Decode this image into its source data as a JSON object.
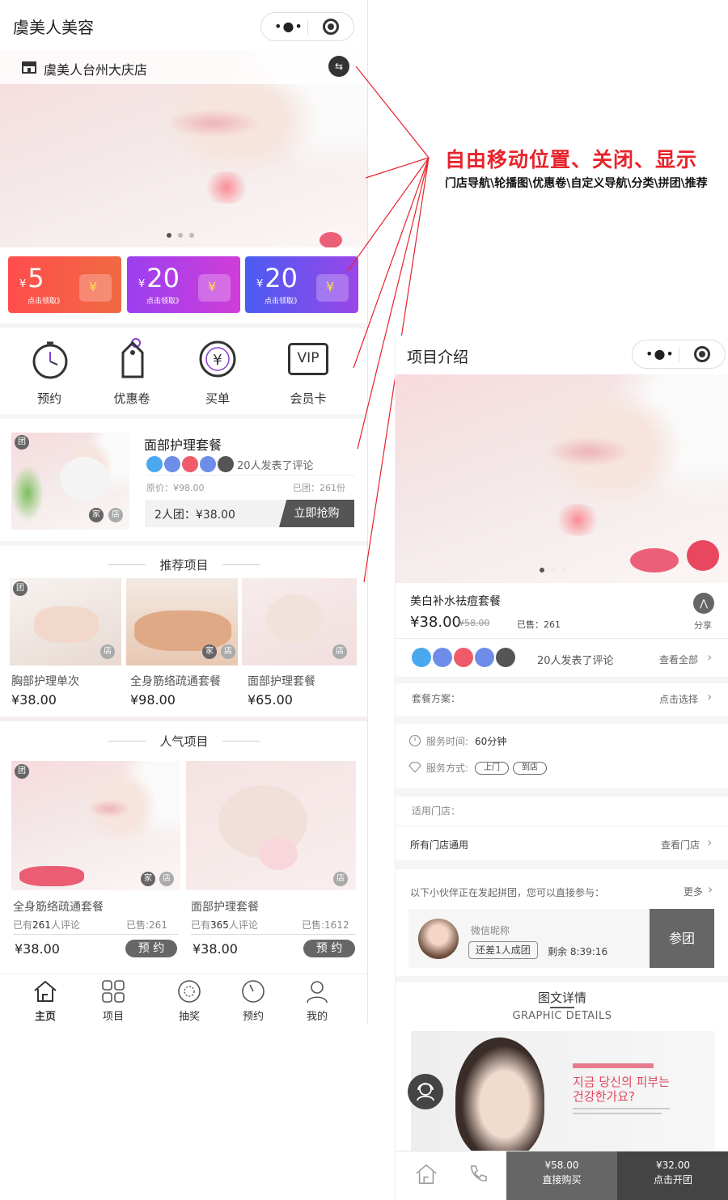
{
  "left_phone": {
    "app_title": "虞美人美容",
    "store_name": "虞美人台州大庆店",
    "coupons": [
      {
        "currency": "¥",
        "amount": "5",
        "cta": "点击领取》",
        "color_from": "#ff4d4d",
        "color_to": "#f06a43"
      },
      {
        "currency": "¥",
        "amount": "20",
        "cta": "点击领取》",
        "color_from": "#9b3ff0",
        "color_to": "#d03ed8"
      },
      {
        "currency": "¥",
        "amount": "20",
        "cta": "点击领取》",
        "color_from": "#4a5cf2",
        "color_to": "#9b46e8"
      }
    ],
    "nav": [
      {
        "label": "预约",
        "icon": "clock-icon"
      },
      {
        "label": "优惠卷",
        "icon": "tag-icon"
      },
      {
        "label": "买单",
        "icon": "yen-icon"
      },
      {
        "label": "会员卡",
        "icon": "vip-card-icon"
      }
    ],
    "vip_text": "VIP",
    "group_deal": {
      "name": "面部护理套餐",
      "review_text": "20人发表了评论",
      "original_price": "原价：¥98.00",
      "sold": "已团：261份",
      "group_price": "2人团：¥38.00",
      "cta": "立即抢购",
      "badge_home": "家",
      "badge_store": "店",
      "group_badge": "团"
    },
    "recommended": {
      "title": "推荐项目",
      "items": [
        {
          "name": "胸部护理单次",
          "price": "¥38.00"
        },
        {
          "name": "全身筋络疏通套餐",
          "price": "¥98.00"
        },
        {
          "name": "面部护理套餐",
          "price": "¥65.00"
        }
      ]
    },
    "popular": {
      "title": "人气项目",
      "items": [
        {
          "name": "全身筋络疏通套餐",
          "reviews_prefix": "已有",
          "reviews_count": "261",
          "reviews_suffix": "人评论",
          "sold": "已售:261",
          "price": "¥38.00",
          "cta": "预 约"
        },
        {
          "name": "面部护理套餐",
          "reviews_prefix": "已有",
          "reviews_count": "365",
          "reviews_suffix": "人评论",
          "sold": "已售:1612",
          "price": "¥38.00",
          "cta": "预 约"
        }
      ]
    },
    "tabs": [
      {
        "label": "主页",
        "icon": "home-icon"
      },
      {
        "label": "项目",
        "icon": "grid-icon"
      },
      {
        "label": "抽奖",
        "icon": "lottery-icon"
      },
      {
        "label": "预约",
        "icon": "timer-icon"
      },
      {
        "label": "我的",
        "icon": "user-icon"
      }
    ]
  },
  "annotation": {
    "headline": "自由移动位置、关闭、显示",
    "subline": "门店导航\\轮播图\\优惠卷\\自定义导航\\分类\\拼团\\推荐"
  },
  "right_phone": {
    "title": "项目介绍",
    "product_name": "美白补水祛痘套餐",
    "price": "¥38.00",
    "original_price": "¥58.00",
    "sold": "已售：261",
    "share": "分享",
    "review_text": "20人发表了评论",
    "view_all": "查看全部",
    "package_label": "套餐方案：",
    "package_action": "点击选择",
    "service_time_label": "服务时间:",
    "service_time_value": "60分钟",
    "service_mode_label": "服务方式:",
    "service_modes": [
      "上门",
      "到店"
    ],
    "stores_label": "适用门店：",
    "stores_value": "所有门店通用",
    "stores_action": "查看门店",
    "group_info": "以下小伙伴正在发起拼团，您可以直接参与：",
    "more": "更多",
    "group_user": "微信昵称",
    "group_need": "还差1人成团",
    "group_remaining": "剩余 8:39:16",
    "join": "参团",
    "details_title": "图文详情",
    "details_subtitle": "GRAPHIC DETAILS",
    "ad_headline_1": "지금 당신의 피부는",
    "ad_headline_2": "건강한가요?",
    "buy_now_price": "¥58.00",
    "buy_now": "直接购买",
    "group_buy_price": "¥32.00",
    "group_buy": "点击开团"
  },
  "colors": {
    "accent_red": "#e8232b",
    "dark_button": "#666666",
    "bottom_bar": "#555555"
  }
}
